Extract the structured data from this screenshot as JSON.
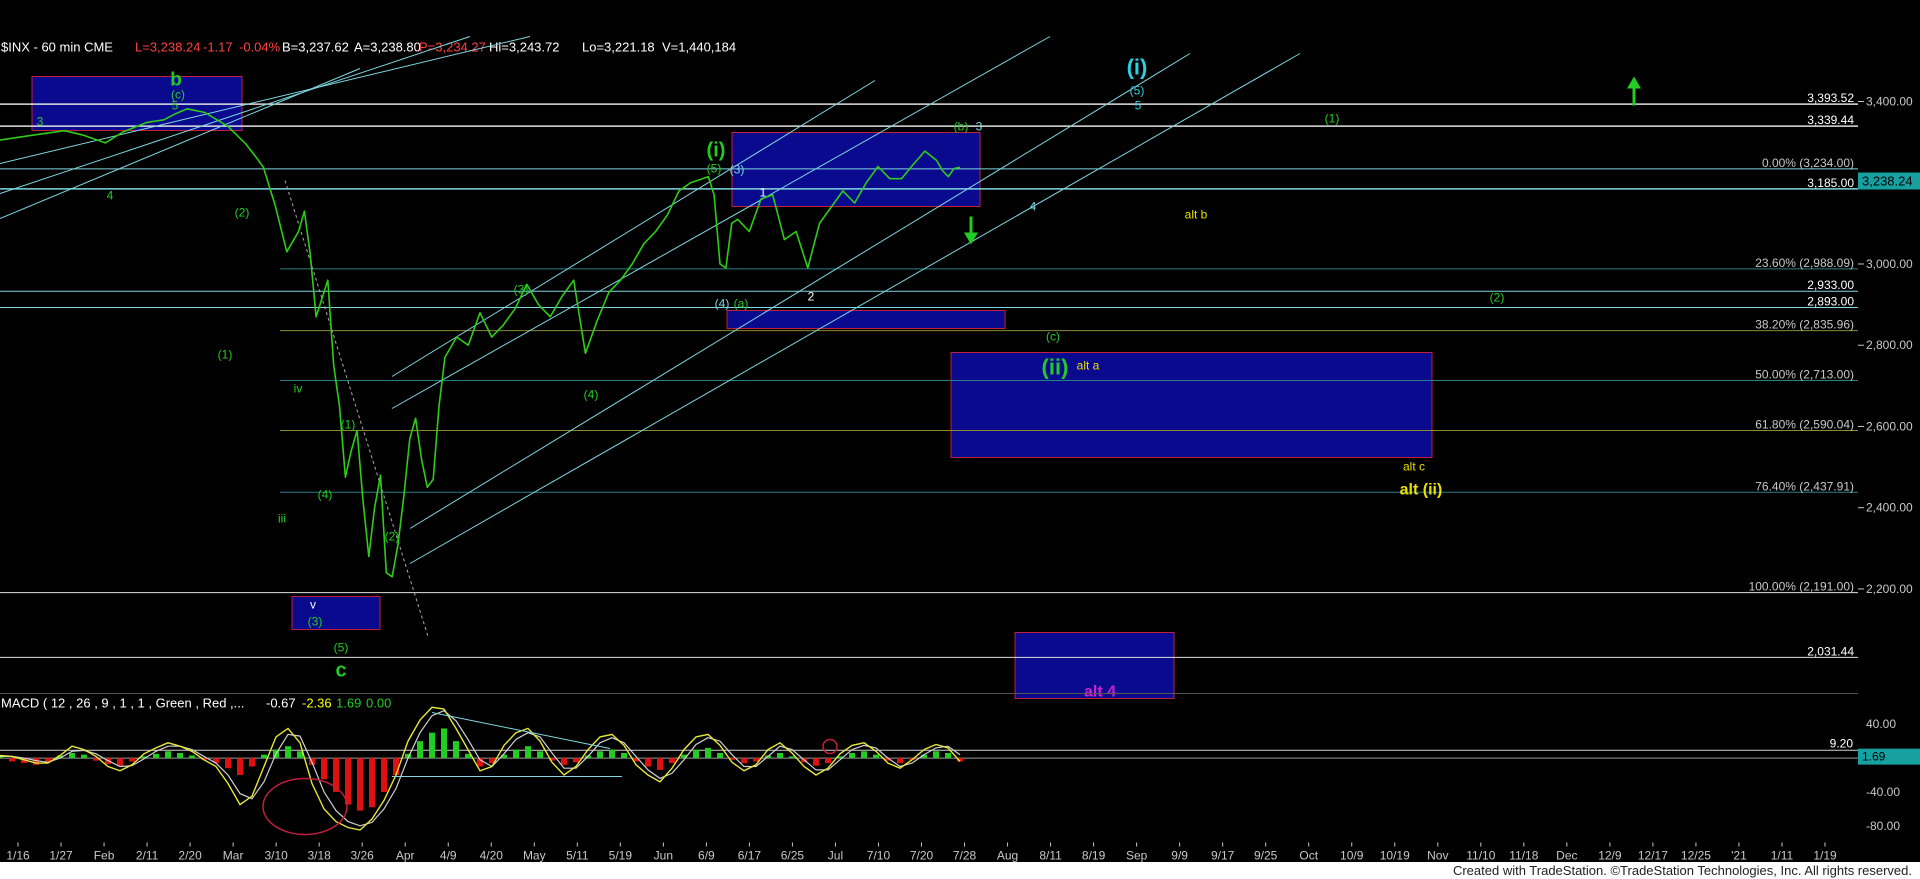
{
  "header": {
    "symbol": "$INX - 60 min  CME",
    "last": "L=3,238.24",
    "change": "-1.17",
    "change_pct": "-0.04%",
    "bid": "B=3,237.62",
    "ask": "A=3,238.80",
    "ref": "P=3,234.27",
    "high": "Hi=3,243.72",
    "low": "Lo=3,221.18",
    "volume": "V=1,440,184"
  },
  "macd_header": {
    "name": "MACD ( 12 , 26 , 9 , 1 , 1 , Green , Red ,...",
    "v1": "-0.67",
    "v2": "-2.36",
    "v3": "1.69",
    "v4": "0.00"
  },
  "colors": {
    "background": "#000000",
    "price": "#2ecc17",
    "line": "#7fd6e0",
    "box_fill": "#0a0a8f",
    "box_border": "#c0203a",
    "yellow": "#e8e000",
    "macd_up": "#22cc22",
    "macd_down": "#dd1111",
    "macd_line": "#e6e63a",
    "signal_line": "#d0d0d0",
    "last_price_tag": "#16a0a0"
  },
  "chart_data": {
    "type": "line",
    "title": "$INX - 60 min",
    "xlabel": "",
    "ylabel": "",
    "ylim": [
      1950,
      3560
    ],
    "grid": false,
    "x_ticks": [
      "1/16",
      "1/27",
      "Feb",
      "2/11",
      "2/20",
      "Mar",
      "3/10",
      "3/18",
      "3/26",
      "Apr",
      "4/9",
      "4/20",
      "May",
      "5/11",
      "5/19",
      "Jun",
      "6/9",
      "6/17",
      "6/25",
      "Jul",
      "7/10",
      "7/20",
      "7/28",
      "Aug",
      "8/11",
      "8/19",
      "Sep",
      "9/9",
      "9/17",
      "9/25",
      "Oct",
      "10/9",
      "10/19",
      "Nov",
      "11/10",
      "11/18",
      "Dec",
      "12/9",
      "12/17",
      "12/25",
      "'21",
      "1/11",
      "1/19"
    ],
    "y_ticks": [
      "3,400.00",
      "3,200.00",
      "3,000.00",
      "2,800.00",
      "2,600.00",
      "2,400.00",
      "2,200.00"
    ],
    "series": [
      {
        "values": [
          [
            0,
            3305
          ],
          [
            6,
            3318
          ],
          [
            11,
            3328
          ],
          [
            14,
            3318
          ],
          [
            18,
            3298
          ],
          [
            21,
            3325
          ],
          [
            25,
            3348
          ],
          [
            28,
            3355
          ],
          [
            30,
            3370
          ],
          [
            32,
            3382
          ],
          [
            35,
            3373
          ],
          [
            39,
            3338
          ],
          [
            42,
            3295
          ],
          [
            44,
            3258
          ],
          [
            45,
            3238
          ],
          [
            47,
            3145
          ],
          [
            49,
            3030
          ],
          [
            51,
            3080
          ],
          [
            52,
            3130
          ],
          [
            53,
            3025
          ],
          [
            54,
            2870
          ],
          [
            56,
            2960
          ],
          [
            57,
            2750
          ],
          [
            58,
            2650
          ],
          [
            59,
            2475
          ],
          [
            60,
            2540
          ],
          [
            61,
            2590
          ],
          [
            62,
            2420
          ],
          [
            63,
            2280
          ],
          [
            64,
            2400
          ],
          [
            65,
            2480
          ],
          [
            66,
            2240
          ],
          [
            67,
            2230
          ],
          [
            68,
            2310
          ],
          [
            69,
            2430
          ],
          [
            70,
            2570
          ],
          [
            71,
            2620
          ],
          [
            72,
            2520
          ],
          [
            73,
            2450
          ],
          [
            74,
            2470
          ],
          [
            75,
            2650
          ],
          [
            76,
            2770
          ],
          [
            78,
            2820
          ],
          [
            80,
            2800
          ],
          [
            82,
            2880
          ],
          [
            84,
            2820
          ],
          [
            86,
            2850
          ],
          [
            88,
            2890
          ],
          [
            90,
            2950
          ],
          [
            92,
            2900
          ],
          [
            94,
            2870
          ],
          [
            96,
            2920
          ],
          [
            98,
            2960
          ],
          [
            100,
            2780
          ],
          [
            102,
            2860
          ],
          [
            104,
            2930
          ],
          [
            106,
            2960
          ],
          [
            108,
            3000
          ],
          [
            110,
            3050
          ],
          [
            112,
            3080
          ],
          [
            114,
            3120
          ],
          [
            116,
            3180
          ],
          [
            118,
            3200
          ],
          [
            120,
            3210
          ],
          [
            121,
            3215
          ],
          [
            122,
            3170
          ],
          [
            123,
            3000
          ],
          [
            124,
            2990
          ],
          [
            125,
            3100
          ],
          [
            126,
            3110
          ],
          [
            128,
            3080
          ],
          [
            130,
            3160
          ],
          [
            132,
            3170
          ],
          [
            134,
            3060
          ],
          [
            136,
            3080
          ],
          [
            138,
            2990
          ],
          [
            140,
            3100
          ],
          [
            142,
            3140
          ],
          [
            144,
            3180
          ],
          [
            146,
            3150
          ],
          [
            148,
            3200
          ],
          [
            150,
            3240
          ],
          [
            152,
            3210
          ],
          [
            154,
            3210
          ],
          [
            156,
            3245
          ],
          [
            158,
            3278
          ],
          [
            160,
            3255
          ],
          [
            161,
            3230
          ],
          [
            162,
            3215
          ],
          [
            163,
            3235
          ],
          [
            164,
            3238
          ]
        ]
      }
    ],
    "horizontal_levels": [
      {
        "value": 3393.52,
        "label": "3,393.52"
      },
      {
        "value": 3339.44,
        "label": "3,339.44"
      },
      {
        "value": 3234.0,
        "label": "0.00% (3,234.00)"
      },
      {
        "value": 3185.0,
        "label": "3,185.00"
      },
      {
        "value": 2988.09,
        "label": "23.60% (2,988.09)"
      },
      {
        "value": 2933.0,
        "label": "2,933.00"
      },
      {
        "value": 2893.0,
        "label": "2,893.00"
      },
      {
        "value": 2835.96,
        "label": "38.20% (2,835.96)"
      },
      {
        "value": 2713.0,
        "label": "50.00% (2,713.00)"
      },
      {
        "value": 2590.04,
        "label": "61.80% (2,590.04)"
      },
      {
        "value": 2437.91,
        "label": "76.40% (2,437.91)"
      },
      {
        "value": 2191.0,
        "label": "100.00% (2,191.00)"
      },
      {
        "value": 2031.44,
        "label": "2,031.44"
      }
    ],
    "last_price": "3,238.24",
    "annotations": [
      {
        "text": "b"
      },
      {
        "text": "(c)"
      },
      {
        "text": "5"
      },
      {
        "text": "3"
      },
      {
        "text": "4"
      },
      {
        "text": "(2)"
      },
      {
        "text": "(1)"
      },
      {
        "text": "iv"
      },
      {
        "text": "iii"
      },
      {
        "text": "v"
      },
      {
        "text": "(4)"
      },
      {
        "text": "(3)"
      },
      {
        "text": "(5)"
      },
      {
        "text": "c"
      },
      {
        "text": "(1)"
      },
      {
        "text": "(2)"
      },
      {
        "text": "(3)"
      },
      {
        "text": "(4)"
      },
      {
        "text": "(i)"
      },
      {
        "text": "(5)"
      },
      {
        "text": "(3)"
      },
      {
        "text": "1"
      },
      {
        "text": "(4)"
      },
      {
        "text": "(a)"
      },
      {
        "text": "2"
      },
      {
        "text": "(b)"
      },
      {
        "text": "3"
      },
      {
        "text": "4"
      },
      {
        "text": "(c)"
      },
      {
        "text": "(ii)"
      },
      {
        "text": "alt a"
      },
      {
        "text": "alt b"
      },
      {
        "text": "alt c"
      },
      {
        "text": "alt (ii)"
      },
      {
        "text": "(i)"
      },
      {
        "text": "(5)"
      },
      {
        "text": "5"
      },
      {
        "text": "(1)"
      },
      {
        "text": "(2)"
      },
      {
        "text": "alt 4"
      }
    ]
  },
  "macd": {
    "ylim": [
      -95,
      55
    ],
    "y_ticks": [
      "40.00",
      "-40.00",
      "-80.00"
    ],
    "level_label": "9.20",
    "current_label": "1.69",
    "histogram": [
      2,
      -4,
      -6,
      -8,
      -5,
      3,
      6,
      4,
      -3,
      -7,
      -9,
      -4,
      2,
      5,
      8,
      6,
      3,
      -2,
      -6,
      -12,
      -20,
      -10,
      4,
      10,
      14,
      8,
      -8,
      -25,
      -40,
      -55,
      -62,
      -58,
      -40,
      -20,
      5,
      20,
      30,
      35,
      20,
      5,
      -10,
      -6,
      4,
      10,
      14,
      8,
      -3,
      -8,
      -5,
      3,
      8,
      10,
      6,
      -4,
      -10,
      -14,
      -6,
      4,
      10,
      12,
      6,
      -2,
      -6,
      -4,
      3,
      6,
      2,
      -5,
      -9,
      -6,
      2,
      6,
      8,
      4,
      -3,
      -6,
      -2,
      4,
      8,
      6,
      -4
    ],
    "macd_line": [
      3,
      2,
      -2,
      -6,
      -6,
      3,
      14,
      10,
      2,
      -10,
      -15,
      -8,
      5,
      12,
      18,
      14,
      8,
      -2,
      -10,
      -30,
      -55,
      -45,
      -10,
      25,
      35,
      18,
      -30,
      -60,
      -75,
      -82,
      -85,
      -72,
      -50,
      -20,
      20,
      45,
      60,
      58,
      35,
      10,
      -15,
      -10,
      15,
      30,
      35,
      20,
      -5,
      -20,
      -10,
      10,
      25,
      28,
      15,
      -8,
      -20,
      -28,
      -12,
      10,
      25,
      28,
      15,
      -5,
      -15,
      -8,
      10,
      18,
      6,
      -10,
      -20,
      -12,
      5,
      15,
      18,
      8,
      -6,
      -12,
      -2,
      10,
      16,
      12,
      -4
    ],
    "signal_line": [
      2,
      2,
      0,
      -3,
      -5,
      0,
      8,
      9,
      5,
      -3,
      -10,
      -9,
      -1,
      8,
      14,
      14,
      10,
      2,
      -6,
      -20,
      -42,
      -48,
      -28,
      5,
      28,
      26,
      -5,
      -40,
      -62,
      -75,
      -80,
      -76,
      -60,
      -36,
      0,
      30,
      50,
      56,
      44,
      22,
      -2,
      -10,
      5,
      22,
      30,
      25,
      6,
      -12,
      -12,
      2,
      18,
      24,
      18,
      2,
      -14,
      -24,
      -18,
      -2,
      16,
      24,
      20,
      4,
      -10,
      -10,
      2,
      14,
      10,
      -2,
      -14,
      -14,
      -2,
      10,
      15,
      12,
      0,
      -10,
      -6,
      4,
      12,
      14,
      4
    ]
  },
  "footer": {
    "text": "Created with TradeStation. ©TradeStation Technologies, Inc. All rights reserved."
  }
}
